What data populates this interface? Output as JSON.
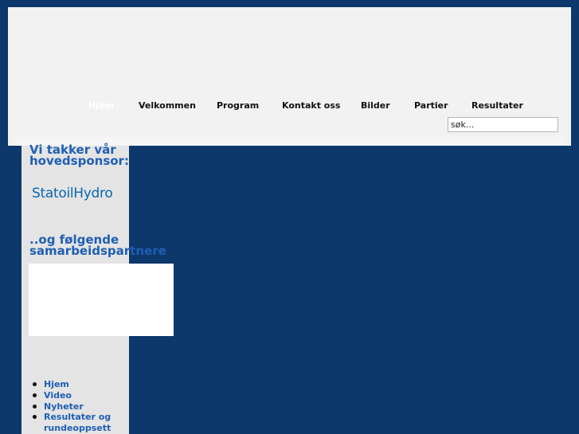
{
  "nav": {
    "items": [
      {
        "label": "Hjem",
        "active": true
      },
      {
        "label": "Velkommen",
        "active": false
      },
      {
        "label": "Program",
        "active": false
      },
      {
        "label": "Kontakt oss",
        "active": false
      },
      {
        "label": "Bilder",
        "active": false
      },
      {
        "label": "Partier",
        "active": false
      },
      {
        "label": "Resultater",
        "active": false
      }
    ]
  },
  "search": {
    "value": "søk..."
  },
  "sidebar": {
    "sponsor_title_line1": "Vi takker vår",
    "sponsor_title_line2": "hovedsponsor:",
    "sponsor_logo_text": "StatoilHydro",
    "partners_title_line1": "..og følgende",
    "partners_title_line2": "samarbeidspartnere",
    "menu": [
      {
        "label": "Hjem"
      },
      {
        "label": "Video"
      },
      {
        "label": "Nyheter"
      },
      {
        "label": "Resultater og rundeoppsett"
      }
    ]
  },
  "colors": {
    "background": "#0c386c",
    "accent": "#1f5fb4",
    "header": "#f2f2f2",
    "sidebar": "#e4e4e4"
  }
}
